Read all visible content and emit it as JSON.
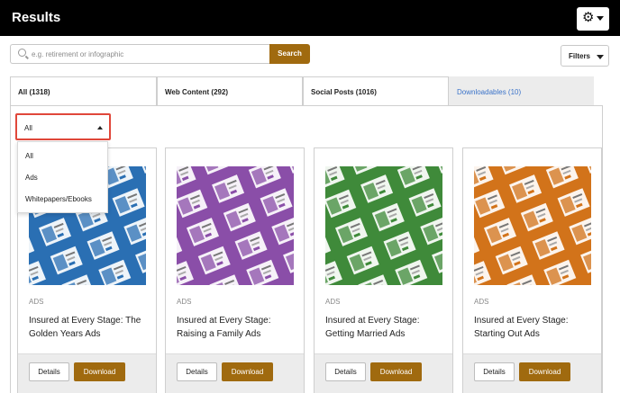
{
  "header": {
    "title": "Results",
    "settings_icon": "gear-icon"
  },
  "search": {
    "placeholder": "e.g. retirement or infographic",
    "button_label": "Search",
    "icon": "search-icon"
  },
  "filters": {
    "label": "Filters"
  },
  "tabs": [
    {
      "label": "All (1318)",
      "active": false
    },
    {
      "label": "Web Content (292)",
      "active": false
    },
    {
      "label": "Social Posts (1016)",
      "active": false
    },
    {
      "label": "Downloadables (10)",
      "active": true
    }
  ],
  "filter_select": {
    "value": "All",
    "options": [
      "All",
      "Ads",
      "Whitepapers/Ebooks"
    ]
  },
  "cards": [
    {
      "tag": "ADS",
      "title": "Insured at Every Stage: The Golden Years Ads",
      "theme_color": "#2a6fb3",
      "details_label": "Details",
      "download_label": "Download"
    },
    {
      "tag": "ADS",
      "title": "Insured at Every Stage: Raising a Family Ads",
      "theme_color": "#8a4ea8",
      "details_label": "Details",
      "download_label": "Download"
    },
    {
      "tag": "ADS",
      "title": "Insured at Every Stage: Getting Married Ads",
      "theme_color": "#3f8a3a",
      "details_label": "Details",
      "download_label": "Download"
    },
    {
      "tag": "ADS",
      "title": "Insured at Every Stage: Starting Out Ads",
      "theme_color": "#d2731a",
      "details_label": "Details",
      "download_label": "Download"
    }
  ],
  "colors": {
    "accent": "#a06a0f",
    "active_tab_text": "#3b73c9",
    "highlight_border": "#e0473a"
  }
}
